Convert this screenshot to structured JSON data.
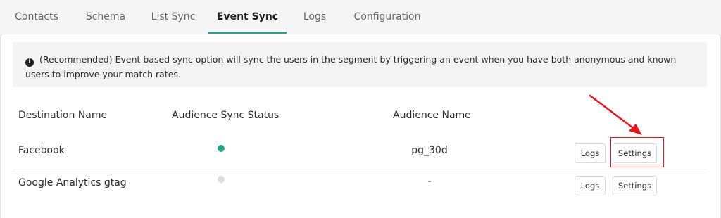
{
  "tabs": [
    {
      "label": "Contacts",
      "active": false
    },
    {
      "label": "Schema",
      "active": false
    },
    {
      "label": "List Sync",
      "active": false
    },
    {
      "label": "Event Sync",
      "active": true
    },
    {
      "label": "Logs",
      "active": false
    },
    {
      "label": "Configuration",
      "active": false
    }
  ],
  "info_banner": {
    "icon": "info-icon",
    "text": "(Recommended) Event based sync option will sync the users in the segment by triggering an event when you have both anonymous and known users to improve your match rates."
  },
  "table": {
    "headers": {
      "destination": "Destination Name",
      "status": "Audience Sync Status",
      "audience": "Audience Name"
    },
    "rows": [
      {
        "destination": "Facebook",
        "status_color": "#26a48c",
        "audience": "pg_30d",
        "logs_label": "Logs",
        "settings_label": "Settings"
      },
      {
        "destination": "Google Analytics gtag",
        "status_color": "#dcdcdc",
        "audience": "-",
        "logs_label": "Logs",
        "settings_label": "Settings"
      }
    ]
  },
  "annotation": {
    "color": "#e8141b"
  }
}
